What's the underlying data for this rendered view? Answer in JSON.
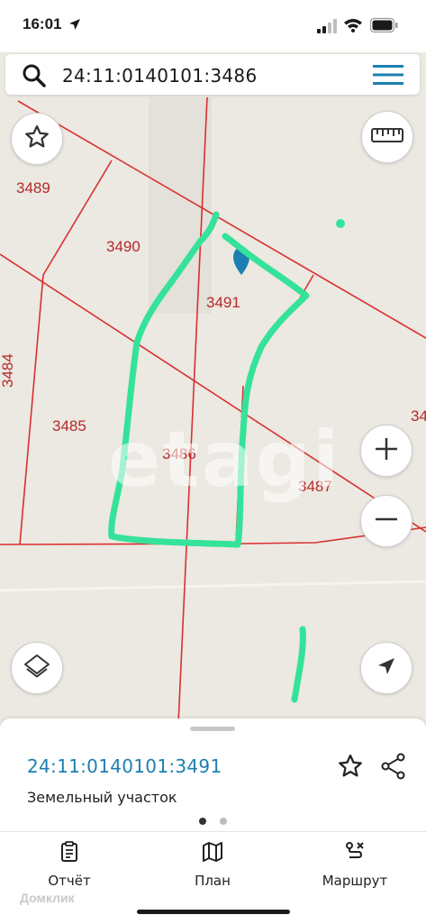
{
  "status_bar": {
    "time": "16:01"
  },
  "search": {
    "query": "24:11:0140101:3486"
  },
  "map": {
    "parcels": [
      "3489",
      "3490",
      "3491",
      "3484",
      "3485",
      "3486",
      "3487",
      "34"
    ],
    "watermark": "etagi"
  },
  "sheet": {
    "cadastral_number": "24:11:0140101:3491",
    "type": "Земельный участок",
    "accent_color": "#1c7fb0"
  },
  "nav": {
    "report": "Отчёт",
    "plan": "План",
    "route": "Маршрут"
  },
  "footer": {
    "brand": "Домклик"
  }
}
